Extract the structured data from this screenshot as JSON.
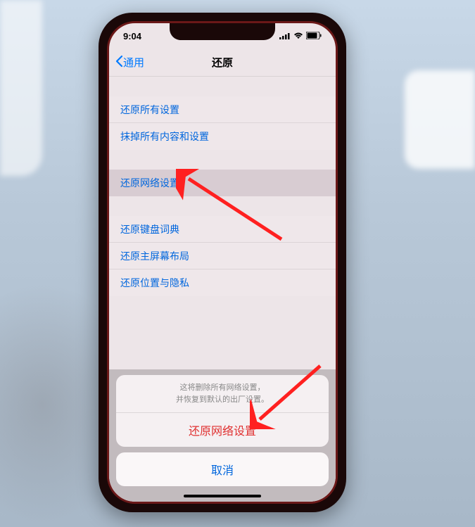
{
  "status_bar": {
    "time": "9:04"
  },
  "nav": {
    "back_label": "通用",
    "title": "还原"
  },
  "group1": {
    "items": [
      {
        "label": "还原所有设置"
      },
      {
        "label": "抹掉所有内容和设置"
      }
    ]
  },
  "group2": {
    "items": [
      {
        "label": "还原网络设置"
      }
    ]
  },
  "group3": {
    "items": [
      {
        "label": "还原键盘词典"
      },
      {
        "label": "还原主屏幕布局"
      },
      {
        "label": "还原位置与隐私"
      }
    ]
  },
  "sheet": {
    "message_line1": "这将删除所有网络设置，",
    "message_line2": "并恢复到默认的出厂设置。",
    "action_label": "还原网络设置",
    "cancel_label": "取消"
  }
}
